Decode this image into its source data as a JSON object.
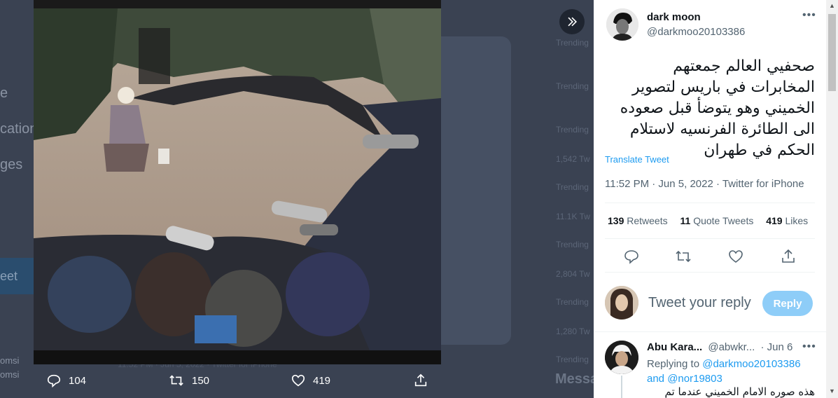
{
  "background": {
    "nav_fragments": [
      "e",
      "cation",
      "ges"
    ],
    "blue_button": "eet",
    "user_fragments": [
      "omsi",
      "omsi"
    ],
    "trending": [
      "Trending",
      "Trending",
      "Trending",
      "1,542 Tw",
      "Trending",
      "11.1K Tw",
      "Trending",
      "2,804 Tw",
      "Trending",
      "1,280 Tw",
      "Trending"
    ],
    "messages": "Messa",
    "footer_fragment": "11:52 PM · Jun 5, 2022 · Twitter for iPhone"
  },
  "photo_actions": {
    "replies": "104",
    "retweets": "150",
    "likes": "419"
  },
  "tweet": {
    "author_name": "dark moon",
    "author_handle": "@darkmoo20103386",
    "text": "صحفيي العالم جمعتهم المخابرات في باريس لتصوير الخميني وهو يتوضأ قبل صعوده الى الطائرة الفرنسيه لاستلام الحكم في طهران",
    "translate_label": "Translate Tweet",
    "meta": "11:52 PM · Jun 5, 2022 · Twitter for iPhone",
    "retweets_count": "139",
    "retweets_label": "Retweets",
    "quote_count": "11",
    "quote_label": "Quote Tweets",
    "likes_count": "419",
    "likes_label": "Likes"
  },
  "reply_composer": {
    "placeholder": "Tweet your reply",
    "button": "Reply"
  },
  "reply": {
    "author_name": "Abu Kara...",
    "author_handle": "@abwkr...",
    "date": "· Jun 6",
    "replying_prefix": "Replying to",
    "replying_to_1": "@darkmoo20103386",
    "and": "and",
    "replying_to_2": "@nor19803",
    "text": "هذه صوره الامام الخميني عندما تم"
  },
  "icons": {
    "expand": "chevrons-right-icon",
    "reply": "reply-icon",
    "retweet": "retweet-icon",
    "like": "heart-icon",
    "share": "share-icon",
    "more": "more-icon"
  },
  "colors": {
    "accent": "#1d9bf0",
    "reply_button_disabled": "#8ecdf8",
    "overlay": "#2c3443"
  }
}
